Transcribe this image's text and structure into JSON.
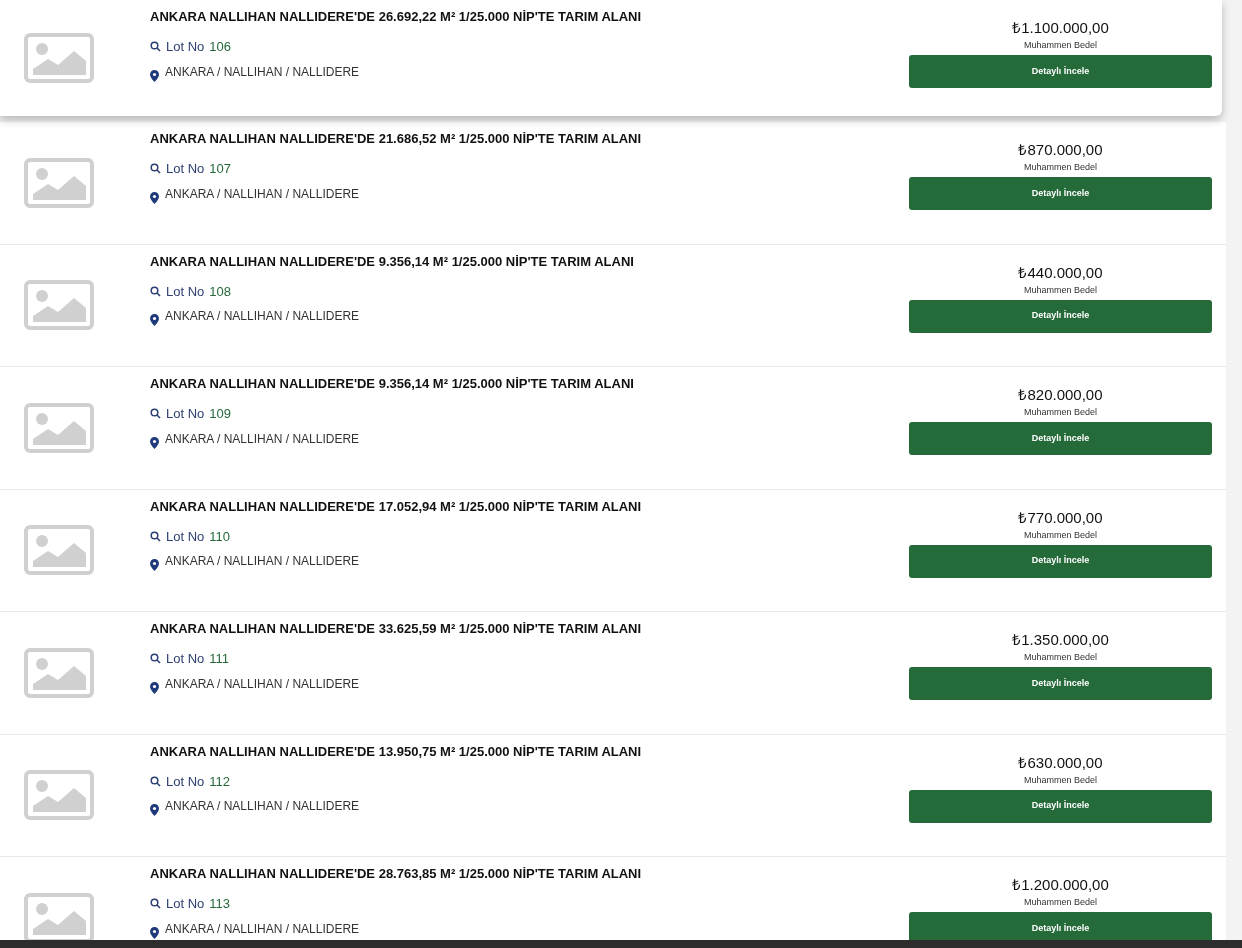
{
  "listings": [
    {
      "title": "ANKARA NALLIHAN NALLIDERE'DE 26.692,22 M² 1/25.000 NİP'TE TARIM ALANI",
      "lot_label": "Lot No",
      "lot_number": "106",
      "location": "ANKARA / NALLIHAN / NALLIDERE",
      "price": "₺1.100.000,00",
      "price_label": "Muhammen Bedel",
      "button": "Detaylı İncele",
      "highlighted": true
    },
    {
      "title": "ANKARA NALLIHAN NALLIDERE'DE 21.686,52 M² 1/25.000 NİP'TE TARIM ALANI",
      "lot_label": "Lot No",
      "lot_number": "107",
      "location": "ANKARA / NALLIHAN / NALLIDERE",
      "price": "₺870.000,00",
      "price_label": "Muhammen Bedel",
      "button": "Detaylı İncele",
      "highlighted": false
    },
    {
      "title": "ANKARA NALLIHAN NALLIDERE'DE 9.356,14 M² 1/25.000 NİP'TE TARIM ALANI",
      "lot_label": "Lot No",
      "lot_number": "108",
      "location": "ANKARA / NALLIHAN / NALLIDERE",
      "price": "₺440.000,00",
      "price_label": "Muhammen Bedel",
      "button": "Detaylı İncele",
      "highlighted": false
    },
    {
      "title": "ANKARA NALLIHAN NALLIDERE'DE 9.356,14 M² 1/25.000 NİP'TE TARIM ALANI",
      "lot_label": "Lot No",
      "lot_number": "109",
      "location": "ANKARA / NALLIHAN / NALLIDERE",
      "price": "₺820.000,00",
      "price_label": "Muhammen Bedel",
      "button": "Detaylı İncele",
      "highlighted": false
    },
    {
      "title": "ANKARA NALLIHAN NALLIDERE'DE 17.052,94 M² 1/25.000 NİP'TE TARIM ALANI",
      "lot_label": "Lot No",
      "lot_number": "110",
      "location": "ANKARA / NALLIHAN / NALLIDERE",
      "price": "₺770.000,00",
      "price_label": "Muhammen Bedel",
      "button": "Detaylı İncele",
      "highlighted": false
    },
    {
      "title": "ANKARA NALLIHAN NALLIDERE'DE 33.625,59 M² 1/25.000 NİP'TE TARIM ALANI",
      "lot_label": "Lot No",
      "lot_number": "111",
      "location": "ANKARA / NALLIHAN / NALLIDERE",
      "price": "₺1.350.000,00",
      "price_label": "Muhammen Bedel",
      "button": "Detaylı İncele",
      "highlighted": false
    },
    {
      "title": "ANKARA NALLIHAN NALLIDERE'DE 13.950,75 M² 1/25.000 NİP'TE TARIM ALANI",
      "lot_label": "Lot No",
      "lot_number": "112",
      "location": "ANKARA / NALLIHAN / NALLIDERE",
      "price": "₺630.000,00",
      "price_label": "Muhammen Bedel",
      "button": "Detaylı İncele",
      "highlighted": false
    },
    {
      "title": "ANKARA NALLIHAN NALLIDERE'DE 28.763,85 M² 1/25.000 NİP'TE TARIM ALANI",
      "lot_label": "Lot No",
      "lot_number": "113",
      "location": "ANKARA / NALLIHAN / NALLIDERE",
      "price": "₺1.200.000,00",
      "price_label": "Muhammen Bedel",
      "button": "Detaylı İncele",
      "highlighted": false
    }
  ]
}
